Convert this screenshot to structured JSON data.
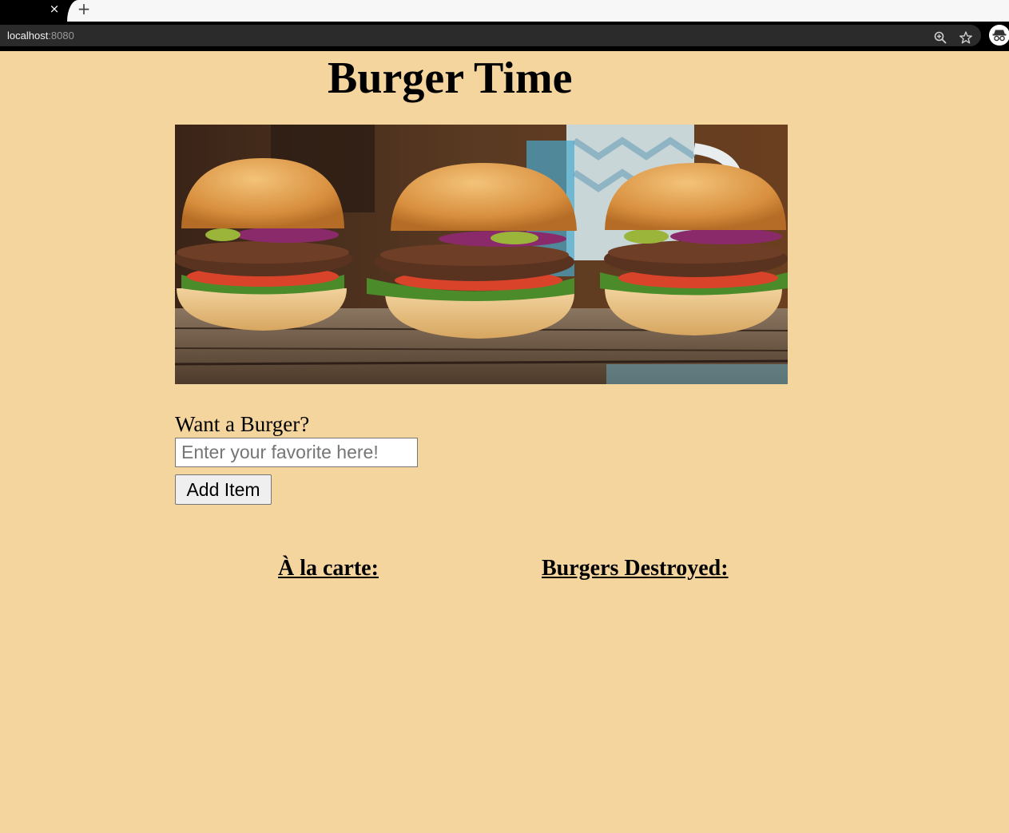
{
  "browser": {
    "tab_close_glyph": "×",
    "new_tab_glyph": "+",
    "url_host": "localhost",
    "url_port": ":8080",
    "icons": [
      "zoom-icon",
      "bookmark-star-icon",
      "incognito-icon"
    ]
  },
  "page": {
    "title": "Burger Time",
    "hero_image": "three-burgers-photo",
    "form": {
      "prompt": "Want a Burger?",
      "input_placeholder": "Enter your favorite here!",
      "input_value": "",
      "submit_label": "Add Item"
    },
    "columns": {
      "menu_heading": "À la carte:",
      "destroyed_heading": "Burgers Destroyed:"
    },
    "colors": {
      "background": "#f5d59e",
      "chrome_dark": "#2b2b2b"
    }
  }
}
